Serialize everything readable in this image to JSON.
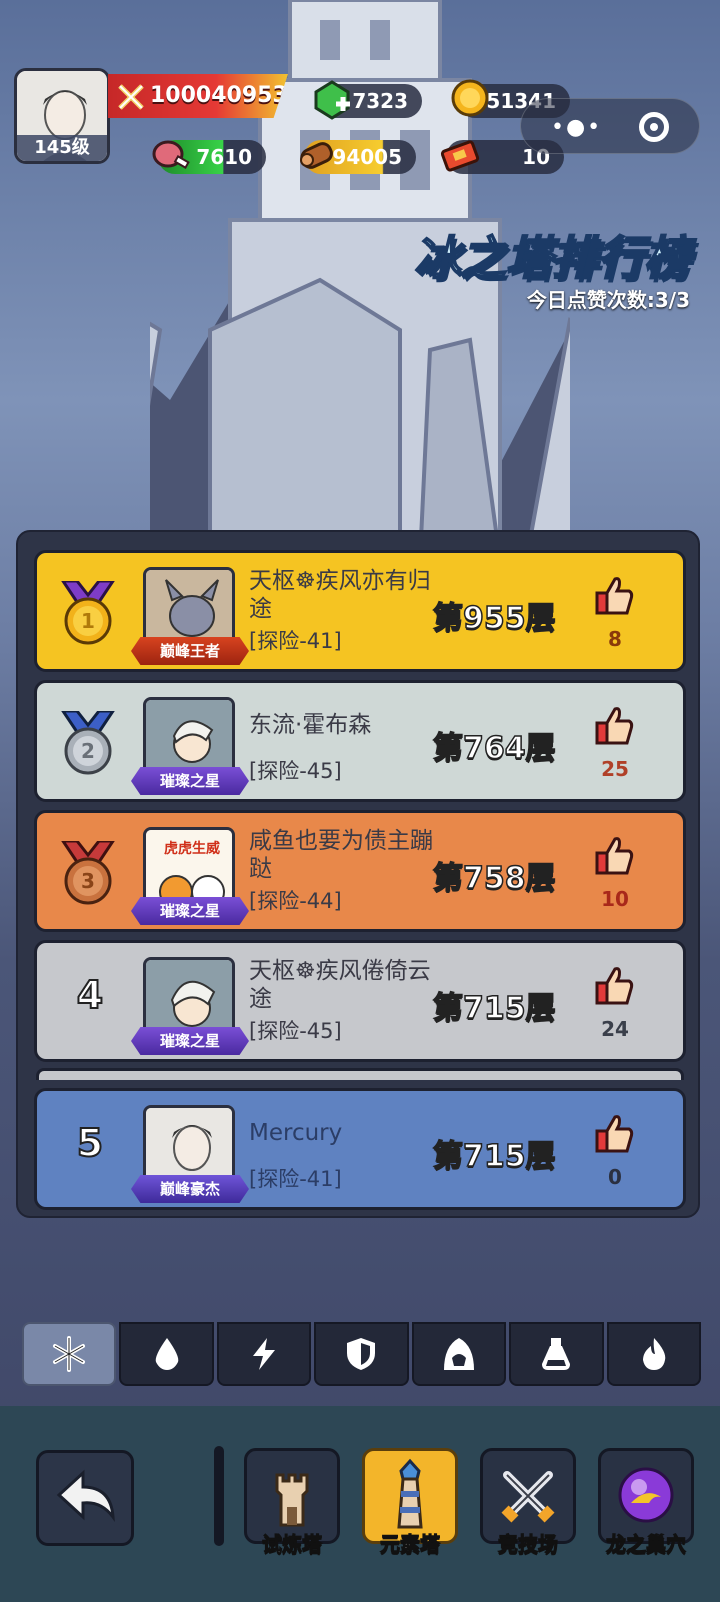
{
  "player": {
    "level": "145级",
    "power": "100040953",
    "gems": "7323",
    "gold": "651341",
    "meat": "7610",
    "wood": "94005",
    "tickets": "10"
  },
  "header": {
    "title": "冰之塔排行榜",
    "likes_today": "今日点赞次数:3/3"
  },
  "ranking": [
    {
      "rank": "1",
      "name": "天枢☸疾风亦有归途",
      "adventure": "[探险-41]",
      "floor": "第955层",
      "likes": "8",
      "badge": "巅峰王者"
    },
    {
      "rank": "2",
      "name": "东流·霍布森",
      "adventure": "[探险-45]",
      "floor": "第764层",
      "likes": "25",
      "badge": "璀璨之星"
    },
    {
      "rank": "3",
      "name": "咸鱼也要为债主蹦跶",
      "adventure": "[探险-44]",
      "floor": "第758层",
      "likes": "10",
      "badge": "璀璨之星",
      "avatar_text": "虎虎生威"
    },
    {
      "rank": "4",
      "name": "天枢☸疾风倦倚云途",
      "adventure": "[探险-45]",
      "floor": "第715层",
      "likes": "24",
      "badge": "璀璨之星"
    }
  ],
  "my_rank": {
    "rank": "5",
    "name": "Mercury",
    "adventure": "[探险-41]",
    "floor": "第715层",
    "likes": "0",
    "badge": "巅峰豪杰"
  },
  "element_tabs": [
    "snowflake-icon",
    "water-drop-icon",
    "lightning-icon",
    "shield-icon",
    "hood-icon",
    "potion-icon",
    "flame-icon"
  ],
  "nav": {
    "trial_tower": "试炼塔",
    "element_tower": "元素塔",
    "arena": "竞技场",
    "dragon_lair": "龙之巢穴"
  },
  "colors": {
    "gold_row": "#f5c422",
    "silver_row": "#cfd8d6",
    "bronze_row": "#e8884a",
    "grey_row": "#c6c8cc",
    "me_row": "#5f82c1",
    "accent": "#f3b52a"
  }
}
